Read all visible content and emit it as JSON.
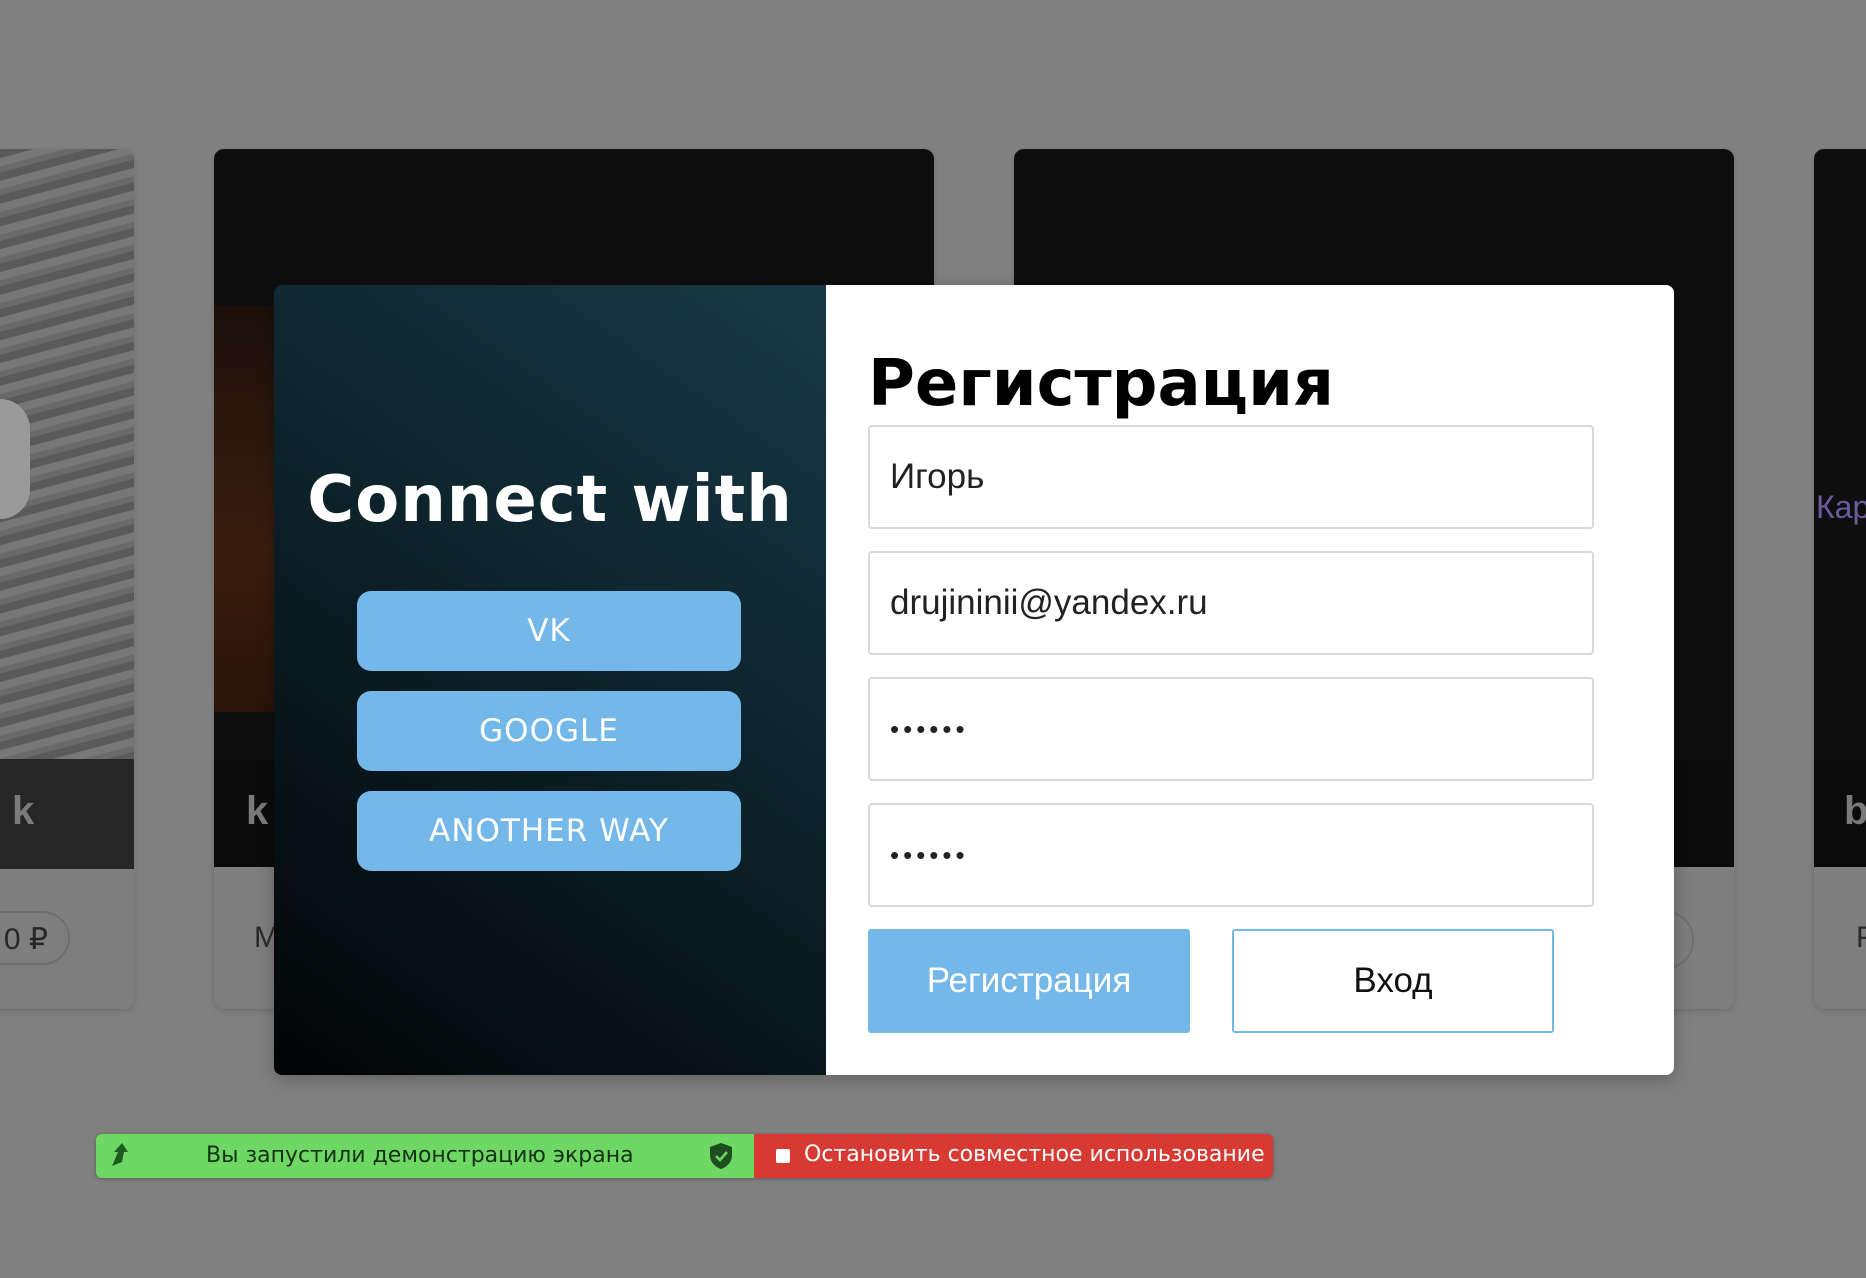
{
  "background": {
    "cards": [
      {
        "caption": "k",
        "footer": "",
        "price": "0 ₽"
      },
      {
        "caption": "k",
        "footer": "М"
      },
      {
        "caption": "",
        "footer": ""
      },
      {
        "caption": "b",
        "footer": "Р",
        "side_text": "Кар"
      }
    ]
  },
  "modal": {
    "left": {
      "title": "Connect with",
      "buttons": {
        "vk": "VK",
        "google": "GOOGLE",
        "other": "ANOTHER WAY"
      }
    },
    "form": {
      "title": "Регистрация",
      "fields": {
        "name": {
          "value": "Игорь",
          "type": "text"
        },
        "email": {
          "value": "drujininii@yandex.ru",
          "type": "text"
        },
        "password": {
          "value": "••••••",
          "type": "password"
        },
        "password_confirm": {
          "value": "••••••",
          "type": "password"
        }
      },
      "register_label": "Регистрация",
      "login_label": "Вход"
    }
  },
  "share_bar": {
    "status_text": "Вы запустили демонстрацию экрана",
    "stop_label": "Остановить совместное использование",
    "colors": {
      "active": "#6fd764",
      "stop": "#d63a33"
    }
  },
  "colors": {
    "accent": "#73b8e8",
    "overlay": "#808080"
  }
}
